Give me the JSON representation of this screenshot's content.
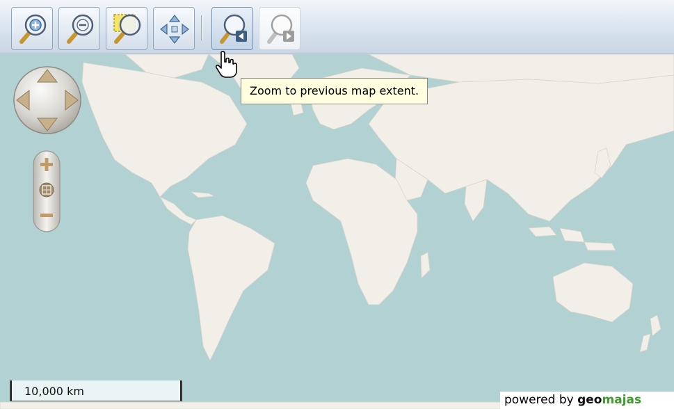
{
  "toolbar": {
    "buttons": [
      {
        "name": "zoom-in",
        "icon": "magnifier-plus-icon",
        "state": "enabled"
      },
      {
        "name": "zoom-out",
        "icon": "magnifier-minus-icon",
        "state": "enabled"
      },
      {
        "name": "zoom-to-rectangle",
        "icon": "magnifier-rectangle-icon",
        "state": "enabled"
      },
      {
        "name": "pan",
        "icon": "pan-arrows-icon",
        "state": "enabled"
      },
      {
        "name": "zoom-previous",
        "icon": "magnifier-back-icon",
        "state": "hovered"
      },
      {
        "name": "zoom-next",
        "icon": "magnifier-forward-icon",
        "state": "disabled"
      }
    ]
  },
  "tooltip": {
    "text": "Zoom to previous map extent."
  },
  "scalebar": {
    "label": "10,000 km"
  },
  "powered_by": {
    "prefix": "powered by ",
    "brand_part1": "geo",
    "brand_part2": "majas"
  },
  "colors": {
    "ocean": "#b1d1d2",
    "land": "#f2efe9",
    "toolbar": "#d4deea",
    "tooltip_bg": "#ffffe0",
    "brand_green": "#3e9c2f"
  },
  "map_controls": {
    "pan": [
      "pan-up-icon",
      "pan-down-icon",
      "pan-left-icon",
      "pan-right-icon"
    ],
    "zoom": [
      "zoom-plus-icon",
      "zoom-max-extent-icon",
      "zoom-minus-icon"
    ]
  }
}
